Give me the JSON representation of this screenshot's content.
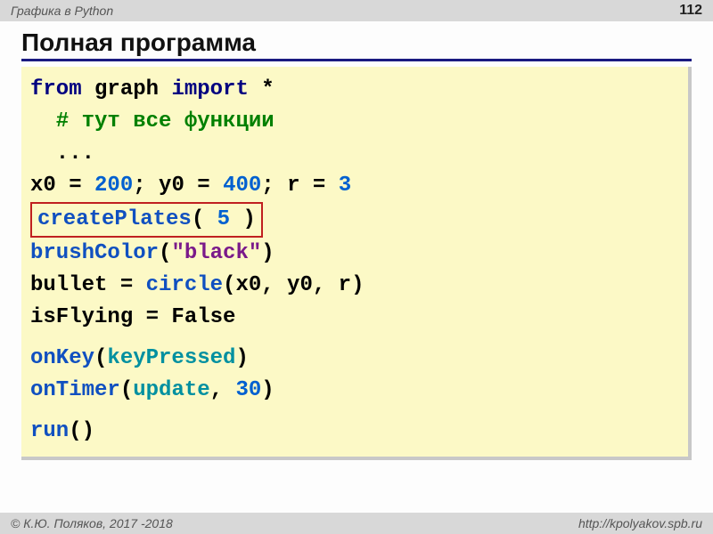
{
  "header": {
    "topic": "Графика в Python",
    "page_number": "112"
  },
  "title": "Полная программа",
  "code": {
    "kw_from": "from",
    "mod": " graph ",
    "kw_import": "import",
    "star": " *",
    "comment": "  # тут все функции",
    "ellipsis": "  ...",
    "x0": "x0 = ",
    "v200": "200",
    "sep1": "; y0 = ",
    "v400": "400",
    "sep2": "; r = ",
    "v3": "3",
    "createPlates": "createPlates",
    "lp1": "( ",
    "v5": "5",
    "rp1": " )",
    "brushColor": "brushColor",
    "lp2": "(",
    "str_black": "\"black\"",
    "rp2": ")",
    "bullet": "bullet = ",
    "circle": "circle",
    "circle_args": "(x0, y0, r)",
    "isFlying": "isFlying = False",
    "onKey": "onKey",
    "lp3": "(",
    "keyPressed": "keyPressed",
    "rp3": ")",
    "onTimer": "onTimer",
    "lp4": "(",
    "update": "update",
    "comma": ", ",
    "v30": "30",
    "rp4": ")",
    "run": "run",
    "run_parens": "()"
  },
  "footer": {
    "copyright": "© К.Ю. Поляков, 2017 -2018",
    "url": "http://kpolyakov.spb.ru"
  }
}
